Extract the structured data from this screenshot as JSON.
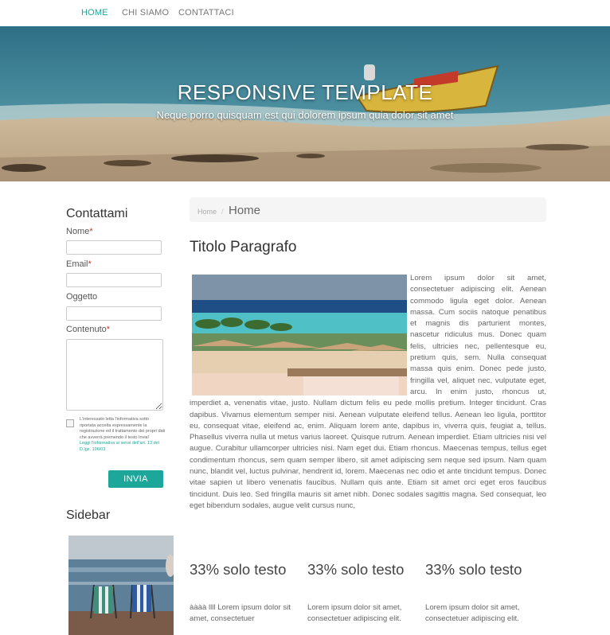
{
  "nav": {
    "items": [
      {
        "label": "HOME",
        "active": true
      },
      {
        "label": "CHI SIAMO",
        "active": false
      },
      {
        "label": "CONTATTACI",
        "active": false
      }
    ]
  },
  "hero": {
    "title": "RESPONSIVE TEMPLATE",
    "subtitle": "Neque porro quisquam est qui dolorem ipsum quia dolor sit amet"
  },
  "contact_form": {
    "title": "Contattami",
    "name_label": "Nome",
    "email_label": "Email",
    "subject_label": "Oggetto",
    "content_label": "Contenuto",
    "required_mark": "*",
    "name_value": "",
    "email_value": "",
    "subject_value": "",
    "content_value": "",
    "privacy_text": "L'interessato letta l'informativa sotto riportata accetta espressamente la registrazione ed il trattamento dei propri dati che avverrà premendo il testo Invia!",
    "privacy_link": "Leggi l'informativa ai sensi dell'art. 13 del D.lgs. 196/03",
    "submit_label": "INVIA"
  },
  "sidebar": {
    "title": "Sidebar"
  },
  "breadcrumb": {
    "home_link": "Home",
    "separator": "/",
    "current": "Home"
  },
  "article": {
    "title": "Titolo Paragrafo",
    "body": "Lorem ipsum dolor sit amet, consectetuer adipiscing elit. Aenean commodo ligula eget dolor. Aenean massa. Cum sociis natoque penatibus et magnis dis parturient montes, nascetur ridiculus mus. Donec quam felis, ultricies nec, pellentesque eu, pretium quis, sem. Nulla consequat massa quis enim. Donec pede justo, fringilla vel, aliquet nec, vulputate eget, arcu. In enim justo, rhoncus ut, imperdiet a, venenatis vitae, justo. Nullam dictum felis eu pede mollis pretium. Integer tincidunt. Cras dapibus. Vivamus elementum semper nisi. Aenean vulputate eleifend tellus. Aenean leo ligula, porttitor eu, consequat vitae, eleifend ac, enim. Aliquam lorem ante, dapibus in, viverra quis, feugiat a, tellus. Phasellus viverra nulla ut metus varius laoreet. Quisque rutrum. Aenean imperdiet. Etiam ultricies nisi vel augue. Curabitur ullamcorper ultricies nisi. Nam eget dui. Etiam rhoncus. Maecenas tempus, tellus eget condimentum rhoncus, sem quam semper libero, sit amet adipiscing sem neque sed ipsum. Nam quam nunc, blandit vel, luctus pulvinar, hendrerit id, lorem. Maecenas nec odio et ante tincidunt tempus. Donec vitae sapien ut libero venenatis faucibus. Nullam quis ante. Etiam sit amet orci eget eros faucibus tincidunt. Duis leo. Sed fringilla mauris sit amet nibh. Donec sodales sagittis magna. Sed consequat, leo eget bibendum sodales, augue velit cursus nunc,"
  },
  "columns": [
    {
      "title": "33% solo testo",
      "text": "àààà llll Lorem ipsum dolor sit amet, consectetuer"
    },
    {
      "title": "33% solo testo",
      "text": "Lorem ipsum dolor sit amet, consectetuer adipiscing elit."
    },
    {
      "title": "33% solo testo",
      "text": "Lorem ipsum dolor sit amet, consectetuer adipiscing elit."
    }
  ],
  "colors": {
    "accent": "#1ca79a",
    "required": "#c0392b"
  }
}
